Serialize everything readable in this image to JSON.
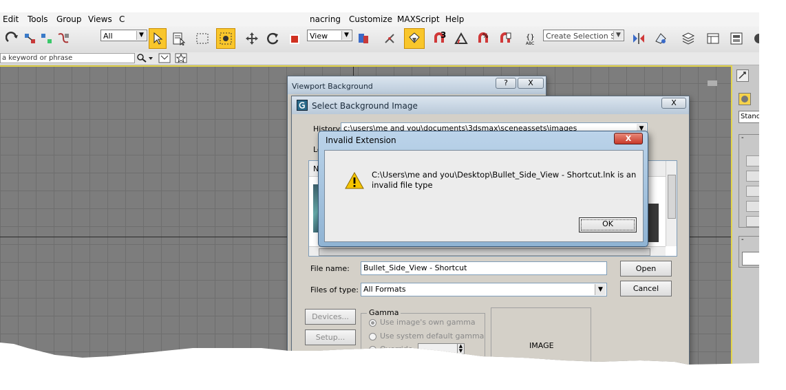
{
  "menubar": {
    "items": [
      "Edit",
      "Tools",
      "Group",
      "Views",
      "C",
      "nacring",
      "Customize",
      "MAXScript",
      "Help"
    ]
  },
  "toolbar": {
    "selection_filter": "All",
    "reference_coord": "View",
    "named_selection_placeholder": "Create Selection Set",
    "angle_snap_badge": "3"
  },
  "search": {
    "placeholder": "a keyword or phrase"
  },
  "viewport_bg_dialog": {
    "title": "Viewport Background",
    "help_label": "?",
    "close_label": "X"
  },
  "select_bg_dialog": {
    "title": "Select Background Image",
    "close_label": "X",
    "history_label": "History:",
    "history_value": "c:\\users\\me and you\\documents\\3dsmax\\sceneassets\\images",
    "look_in_label": "Lo",
    "name_col_label": "Na",
    "file_name_label": "File name:",
    "file_name_value": "Bullet_Side_View - Shortcut",
    "files_of_type_label": "Files of type:",
    "files_of_type_value": "All Formats",
    "open_label": "Open",
    "cancel_label": "Cancel",
    "devices_label": "Devices...",
    "setup_label": "Setup...",
    "gamma": {
      "title": "Gamma",
      "opt_own": "Use image's own gamma",
      "opt_system": "Use system default gamma",
      "opt_override": "Override"
    },
    "preview_label": "IMAGE"
  },
  "invalid_dialog": {
    "title": "Invalid Extension",
    "close_label": "X",
    "message_line1": "C:\\Users\\me and you\\Desktop\\Bullet_Side_View - Shortcut.lnk is an",
    "message_line2": "invalid file type",
    "ok_label": "OK"
  },
  "right_panel": {
    "stand_label": "Stanc"
  },
  "colors": {
    "viewport": "#7d7d7d",
    "dialog_face": "#d4d0c8",
    "active_frame": "#e5d64a",
    "warning": "#f5c400"
  }
}
